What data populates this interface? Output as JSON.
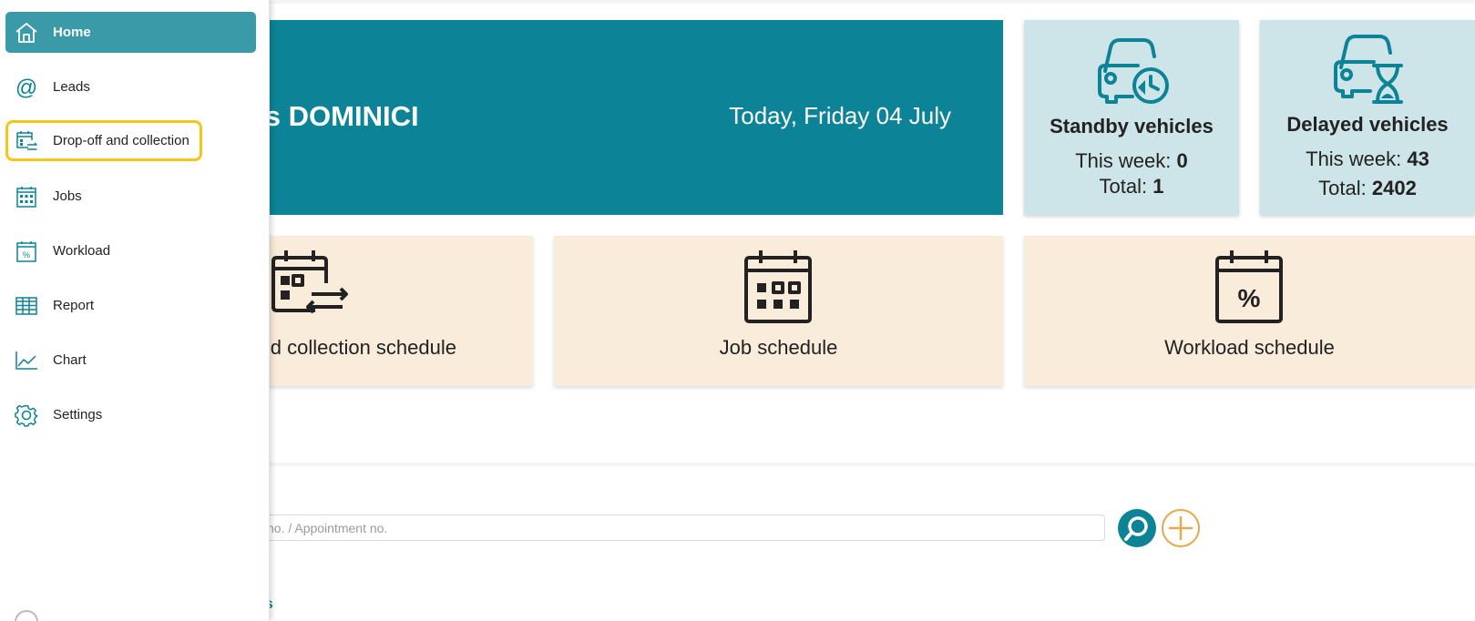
{
  "header": {
    "welcome_name": "mas DOMINICI",
    "date_text": "Today, Friday 04 July"
  },
  "stats": {
    "standby": {
      "title": "Standby vehicles",
      "week_label": "This week: ",
      "week_value": "0",
      "total_label": "Total: ",
      "total_value": "1",
      "icon": "car-clock-icon"
    },
    "delayed": {
      "title": "Delayed vehicles",
      "week_label": "This week: ",
      "week_value": "43",
      "total_label": "Total: ",
      "total_value": "2402",
      "icon": "car-hourglass-icon"
    }
  },
  "tiles": {
    "dropoff": {
      "label": "d collection schedule",
      "icon": "calendar-transfer-icon"
    },
    "jobs": {
      "label": "Job schedule",
      "icon": "calendar-grid-icon"
    },
    "workload": {
      "label": "Workload schedule",
      "icon": "calendar-percent-icon"
    }
  },
  "search": {
    "placeholder": "no. / Appointment no."
  },
  "bottom_link": "es",
  "sidebar": {
    "items": [
      {
        "label": "Home",
        "icon": "home-icon"
      },
      {
        "label": "Leads",
        "icon": "at-icon"
      },
      {
        "label": "Drop-off and collection",
        "icon": "calendar-transfer-icon"
      },
      {
        "label": "Jobs",
        "icon": "calendar-grid-icon"
      },
      {
        "label": "Workload",
        "icon": "calendar-percent-icon"
      },
      {
        "label": "Report",
        "icon": "table-icon"
      },
      {
        "label": "Chart",
        "icon": "chart-line-icon"
      },
      {
        "label": "Settings",
        "icon": "gear-icon"
      }
    ]
  },
  "colors": {
    "teal": "#0c8396",
    "active_nav": "#3a9aa8",
    "stat_bg": "#cde5e9",
    "tile_bg": "#f9ecdb",
    "highlight": "#f5c518",
    "add_accent": "#e8a94a"
  }
}
